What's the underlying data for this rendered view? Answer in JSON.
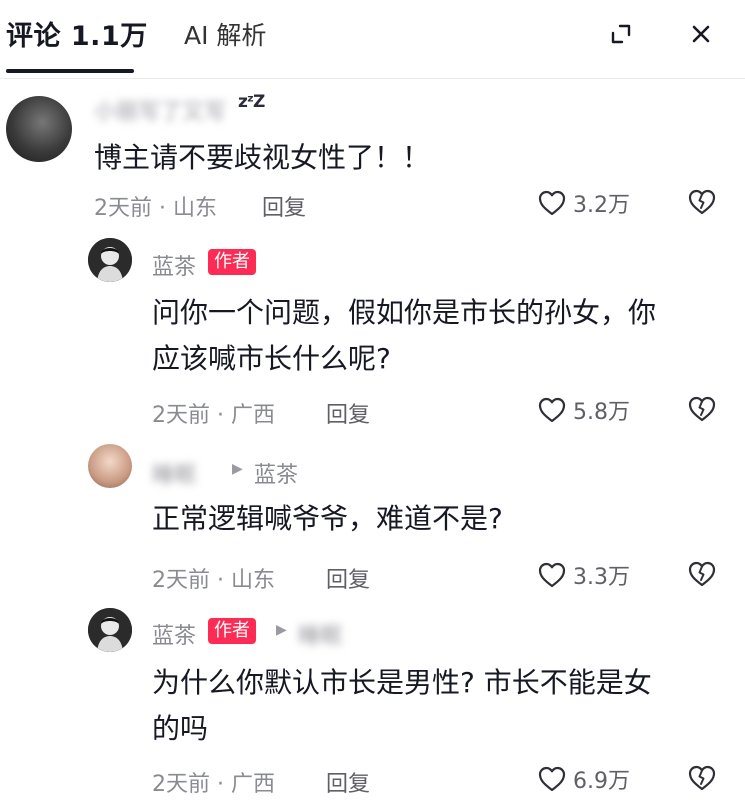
{
  "header": {
    "tab_comments": "评论 1.1万",
    "tab_ai": "AI 解析",
    "expand_icon": "expand-corners-icon",
    "close_icon": "close-icon"
  },
  "comments": [
    {
      "username": "小丽写了又写",
      "content_lines": [
        "博主请不要歧视女性了！！"
      ],
      "time_location": "2天前 · 山东",
      "reply_label": "回复",
      "likes": "3.2万"
    },
    {
      "username": "蓝茶",
      "badge": "作者",
      "content_lines": [
        "问你一个问题，假如你是市长的孙女，你",
        "应该喊市长什么呢?"
      ],
      "time_location": "2天前 · 广西",
      "reply_label": "回复",
      "likes": "5.8万"
    },
    {
      "username": "睡眠",
      "reply_to": "蓝茶",
      "content_lines": [
        "正常逻辑喊爷爷，难道不是?"
      ],
      "time_location": "2天前 · 山东",
      "reply_label": "回复",
      "likes": "3.3万"
    },
    {
      "username": "蓝茶",
      "badge": "作者",
      "reply_to": "睡眠",
      "content_lines": [
        "为什么你默认市长是男性? 市长不能是女",
        "的吗"
      ],
      "time_location": "2天前 · 广西",
      "reply_label": "回复",
      "likes": "6.9万"
    }
  ]
}
